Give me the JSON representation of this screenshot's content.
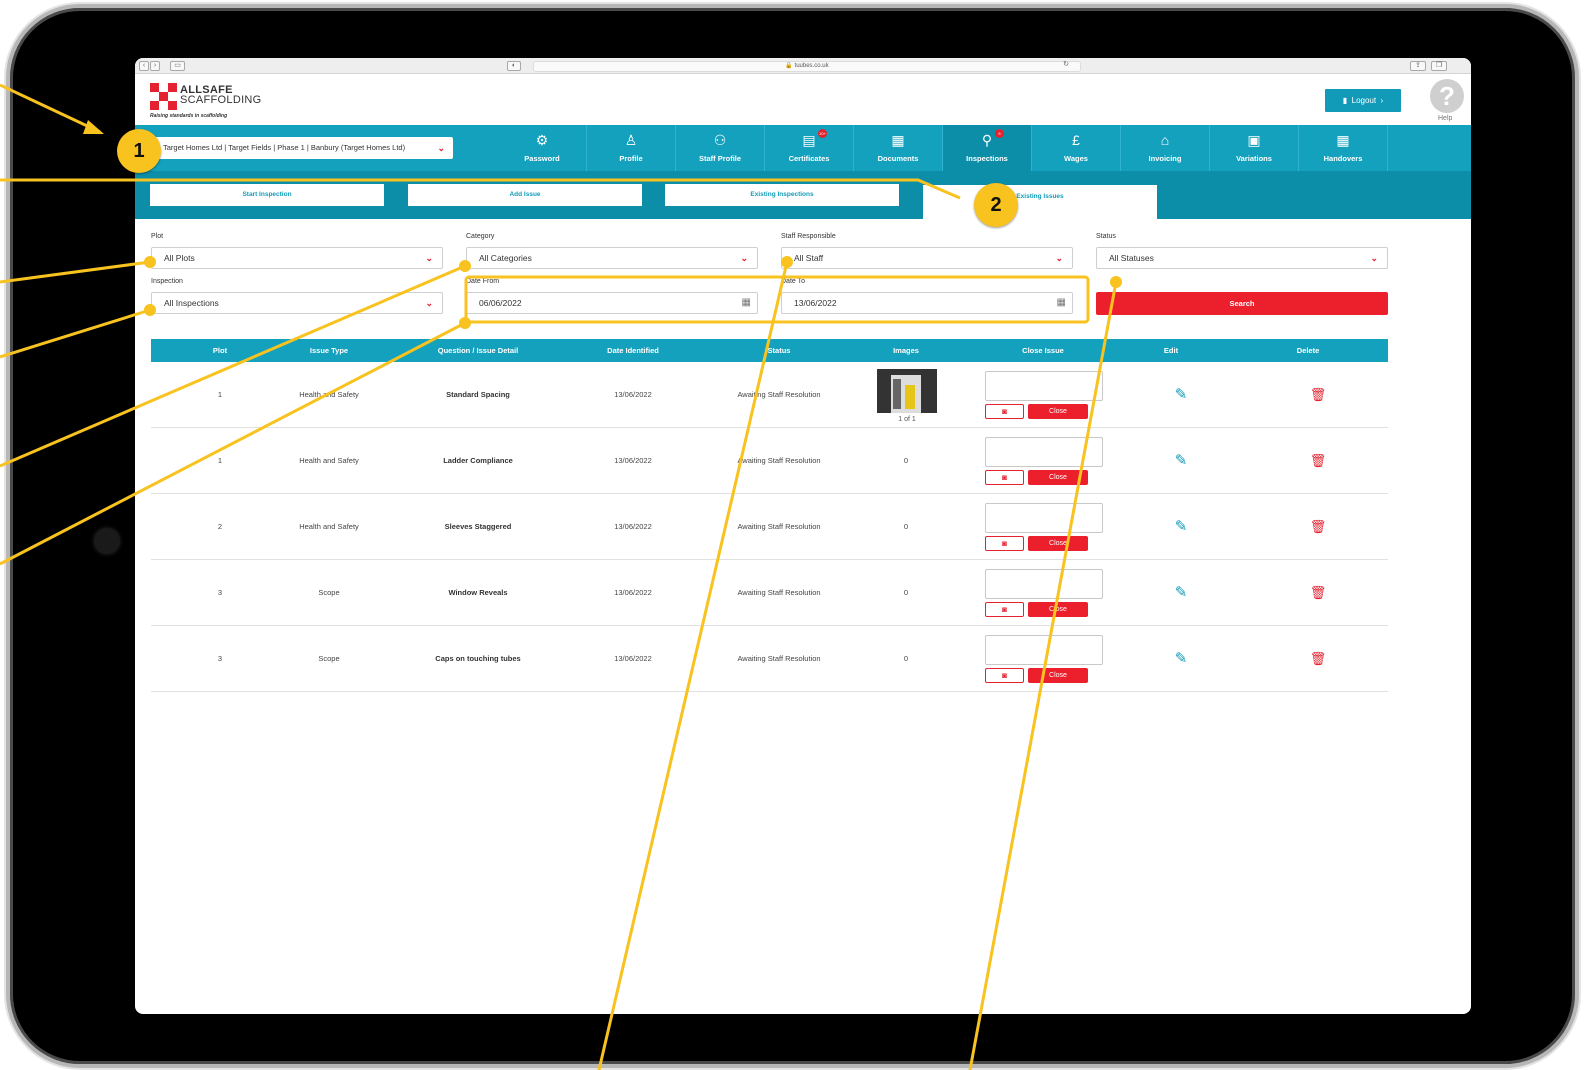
{
  "browser": {
    "url": "tuubes.co.uk",
    "nav_back": "‹",
    "nav_forward": "›"
  },
  "brand": {
    "name_line1": "ALLSAFE",
    "name_line2": "SCAFFOLDING",
    "tagline": "Raising standards in scaffolding",
    "accent_color": "#e52330",
    "primary_color": "#14a1bd"
  },
  "header": {
    "logout_label": "Logout",
    "help_label": "Help"
  },
  "site_selector": {
    "value": "Target Homes Ltd | Target Fields | Phase 1 | Banbury (Target Homes Ltd)"
  },
  "nav": {
    "items": [
      {
        "label": "Password",
        "icon": "gear-icon"
      },
      {
        "label": "Profile",
        "icon": "person-icon"
      },
      {
        "label": "Staff Profile",
        "icon": "people-icon"
      },
      {
        "label": "Certificates",
        "icon": "certificate-icon",
        "badge": "10+"
      },
      {
        "label": "Documents",
        "icon": "document-icon"
      },
      {
        "label": "Inspections",
        "icon": "search-icon",
        "badge": "5"
      },
      {
        "label": "Wages",
        "icon": "pound-icon"
      },
      {
        "label": "Invoicing",
        "icon": "home-icon"
      },
      {
        "label": "Variations",
        "icon": "grid-icon"
      },
      {
        "label": "Handovers",
        "icon": "document-icon"
      }
    ],
    "active": "Inspections"
  },
  "subnav": {
    "tabs": [
      "Start Inspection",
      "Add Issue",
      "Existing Inspections",
      "Existing Issues"
    ],
    "active": "Existing Issues"
  },
  "filters": {
    "plot": {
      "label": "Plot",
      "value": "All Plots"
    },
    "category": {
      "label": "Category",
      "value": "All Categories"
    },
    "staff": {
      "label": "Staff Responsible",
      "value": "All Staff"
    },
    "status": {
      "label": "Status",
      "value": "All Statuses"
    },
    "inspection": {
      "label": "Inspection",
      "value": "All Inspections"
    },
    "date_from": {
      "label": "Date From",
      "value": "06/06/2022"
    },
    "date_to": {
      "label": "Date To",
      "value": "13/06/2022"
    },
    "search_label": "Search"
  },
  "table": {
    "headers": [
      "Plot",
      "Issue Type",
      "Question / Issue Detail",
      "Date Identified",
      "Status",
      "Images",
      "Close Issue",
      "Edit",
      "Delete"
    ],
    "rows": [
      {
        "plot": "1",
        "type": "Health and Safety",
        "detail": "Standard Spacing",
        "date": "13/06/2022",
        "status": "Awaiting Staff Resolution",
        "images": "1 of 1"
      },
      {
        "plot": "1",
        "type": "Health and Safety",
        "detail": "Ladder Compliance",
        "date": "13/06/2022",
        "status": "Awaiting Staff Resolution",
        "images": "0"
      },
      {
        "plot": "2",
        "type": "Health and Safety",
        "detail": "Sleeves Staggered",
        "date": "13/06/2022",
        "status": "Awaiting Staff Resolution",
        "images": "0"
      },
      {
        "plot": "3",
        "type": "Scope",
        "detail": "Window Reveals",
        "date": "13/06/2022",
        "status": "Awaiting Staff Resolution",
        "images": "0"
      },
      {
        "plot": "3",
        "type": "Scope",
        "detail": "Caps on touching tubes",
        "date": "13/06/2022",
        "status": "Awaiting Staff Resolution",
        "images": "0"
      }
    ],
    "close_label": "Close"
  },
  "callouts": {
    "one": "1",
    "two": "2",
    "color": "#f8c21f"
  }
}
